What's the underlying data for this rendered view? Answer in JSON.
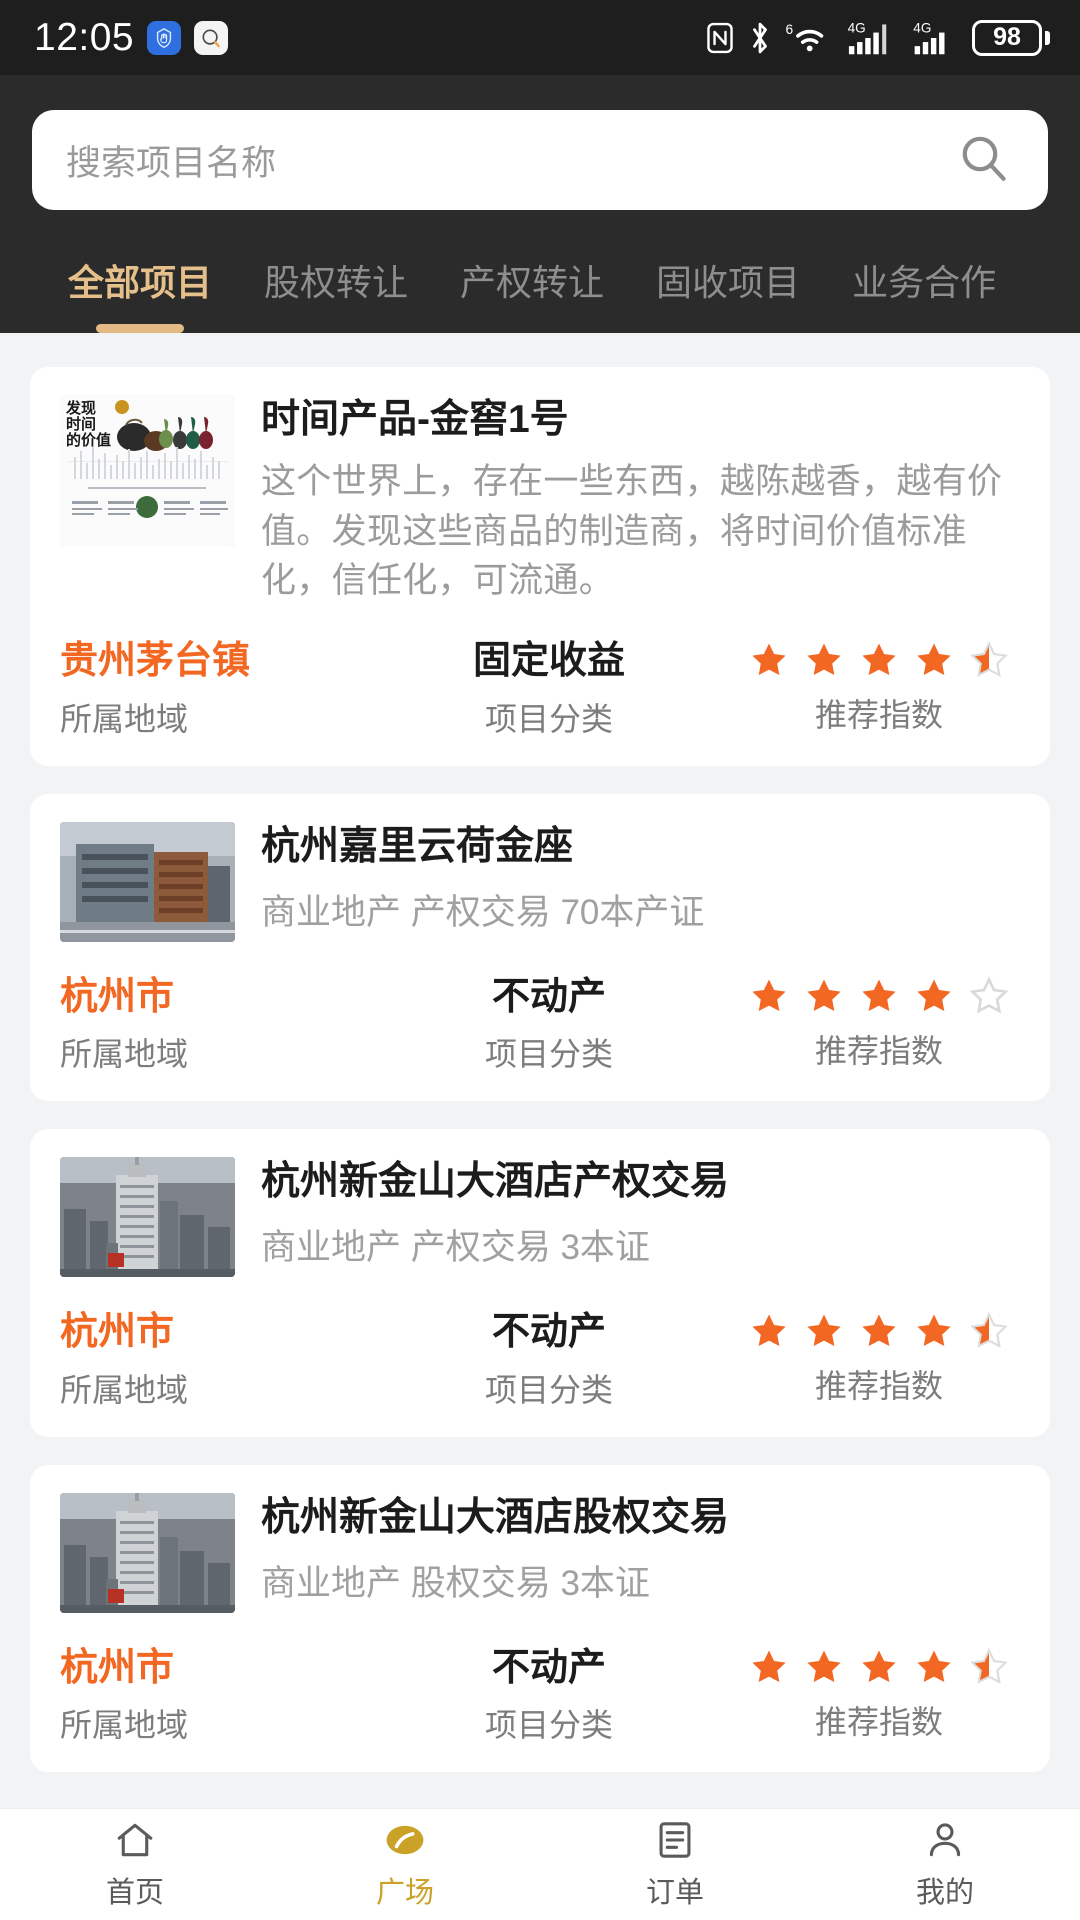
{
  "statusbar": {
    "time": "12:05",
    "battery": "98",
    "icons": [
      "nfc-icon",
      "bluetooth-icon",
      "wifi-6-icon",
      "signal-4g-icon",
      "signal-4g-secondary-icon",
      "battery-icon"
    ],
    "notif_blue": "hand-shield-icon",
    "notif_white": "message-icon"
  },
  "search": {
    "placeholder": "搜索项目名称",
    "value": "",
    "icon": "search-icon"
  },
  "tabs": [
    {
      "label": "全部项目",
      "active": true
    },
    {
      "label": "股权转让",
      "active": false
    },
    {
      "label": "产权转让",
      "active": false
    },
    {
      "label": "固收项目",
      "active": false
    },
    {
      "label": "业务合作",
      "active": false
    }
  ],
  "labels": {
    "region": "所属地域",
    "category": "项目分类",
    "rating": "推荐指数"
  },
  "colors": {
    "accent_orange": "#f26722",
    "accent_gold": "#e3ba83",
    "header_bg": "#2b2b2b",
    "status_bg": "#1e1e1e",
    "page_bg": "#f2f3f5",
    "nav_active": "#c9a227"
  },
  "cards": [
    {
      "title": "时间产品-金窖1号",
      "desc": "这个世界上，存在一些东西，越陈越香，越有价值。发现这些商品的制造商，将时间价值标准化，信任化，可流通。",
      "sub": "",
      "thumb": "wine-poster-thumbnail",
      "region": "贵州茅台镇",
      "category": "固定收益",
      "stars_full": 4,
      "stars_half": 1,
      "stars_empty": 0
    },
    {
      "title": "杭州嘉里云荷金座",
      "desc": "",
      "sub": "商业地产 产权交易 70本产证",
      "thumb": "building-thumbnail",
      "region": "杭州市",
      "category": "不动产",
      "stars_full": 4,
      "stars_half": 0,
      "stars_empty": 1
    },
    {
      "title": "杭州新金山大酒店产权交易",
      "desc": "",
      "sub": "商业地产 产权交易 3本证",
      "thumb": "cityscape-thumbnail",
      "region": "杭州市",
      "category": "不动产",
      "stars_full": 4,
      "stars_half": 1,
      "stars_empty": 0
    },
    {
      "title": "杭州新金山大酒店股权交易",
      "desc": "",
      "sub": "商业地产 股权交易 3本证",
      "thumb": "cityscape-thumbnail",
      "region": "杭州市",
      "category": "不动产",
      "stars_full": 4,
      "stars_half": 1,
      "stars_empty": 0
    }
  ],
  "bottomnav": [
    {
      "label": "首页",
      "icon": "home-icon",
      "active": false
    },
    {
      "label": "广场",
      "icon": "plaza-icon",
      "active": true
    },
    {
      "label": "订单",
      "icon": "order-list-icon",
      "active": false
    },
    {
      "label": "我的",
      "icon": "person-icon",
      "active": false
    }
  ],
  "thumb_poster": {
    "line1": "发现",
    "line2": "时间",
    "line3": "的价值"
  }
}
